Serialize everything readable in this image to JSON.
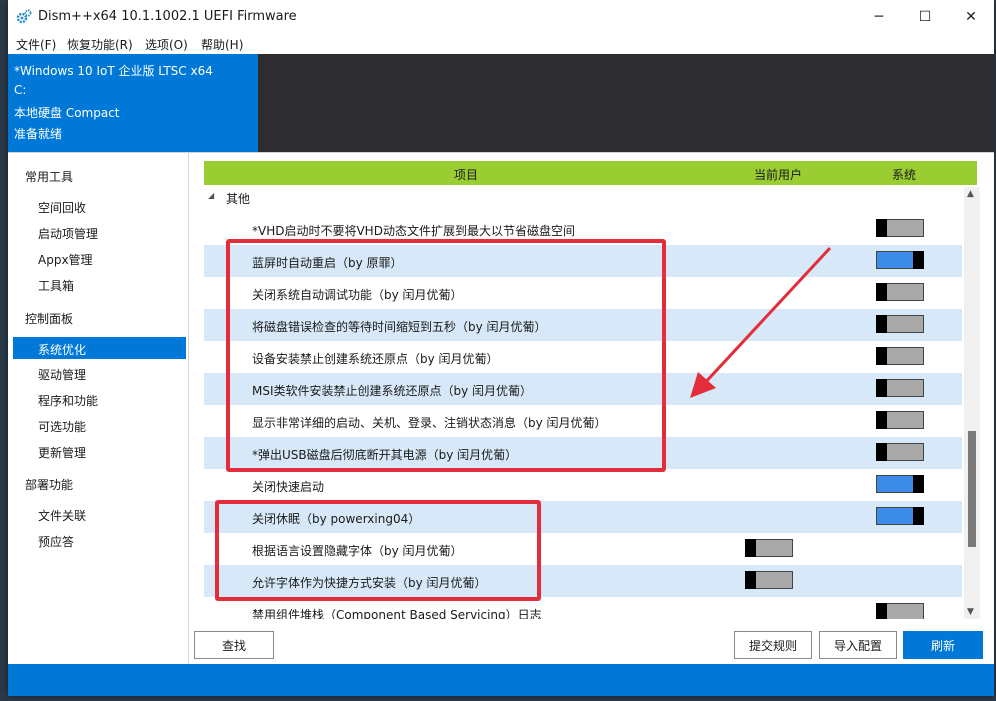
{
  "window": {
    "title": "Dism++x64 10.1.1002.1 UEFI Firmware",
    "minimize": "─",
    "maximize": "☐",
    "close": "✕"
  },
  "menu": [
    "文件(F)",
    "恢复功能(R)",
    "选项(O)",
    "帮助(H)"
  ],
  "info": {
    "os": "*Windows 10 IoT 企业版 LTSC x64",
    "drive": "C:",
    "disk": "本地硬盘 Compact",
    "status": "准备就绪"
  },
  "sidebar": {
    "groups": [
      {
        "label": "常用工具",
        "items": [
          "空间回收",
          "启动项管理",
          "Appx管理",
          "工具箱"
        ]
      },
      {
        "label": "控制面板",
        "items": [
          "系统优化",
          "驱动管理",
          "程序和功能",
          "可选功能",
          "更新管理"
        ]
      },
      {
        "label": "部署功能",
        "items": [
          "文件关联",
          "预应答"
        ]
      }
    ],
    "selected": "系统优化"
  },
  "table": {
    "col_item": "项目",
    "col_user": "当前用户",
    "col_system": "系统",
    "group_label": "其他",
    "rows": [
      {
        "label": "*VHD启动时不要将VHD动态文件扩展到最大以节省磁盘空间",
        "system": "off"
      },
      {
        "label": "蓝屏时自动重启（by 原罪）",
        "system": "on"
      },
      {
        "label": "关闭系统自动调试功能（by 闰月优葡）",
        "system": "off"
      },
      {
        "label": "将磁盘错误检查的等待时间缩短到五秒（by 闰月优葡）",
        "system": "off"
      },
      {
        "label": "设备安装禁止创建系统还原点（by 闰月优葡）",
        "system": "off"
      },
      {
        "label": "MSI类软件安装禁止创建系统还原点（by 闰月优葡）",
        "system": "off"
      },
      {
        "label": "显示非常详细的启动、关机、登录、注销状态消息（by 闰月优葡）",
        "system": "off"
      },
      {
        "label": "*弹出USB磁盘后彻底断开其电源（by 闰月优葡）",
        "system": "off"
      },
      {
        "label": "关闭快速启动",
        "system": "on"
      },
      {
        "label": "关闭休眠（by powerxing04）",
        "system": "on"
      },
      {
        "label": "根据语言设置隐藏字体（by 闰月优葡）",
        "user": "off"
      },
      {
        "label": "允许字体作为快捷方式安装（by 闰月优葡）",
        "user": "off"
      },
      {
        "label": "禁用组件堆栈（Component Based Servicing）日志",
        "system": "off"
      }
    ]
  },
  "buttons": {
    "find": "查找",
    "submit": "提交规则",
    "import": "导入配置",
    "refresh": "刷新"
  },
  "icons": {
    "collapse": "triangle-down-icon",
    "app": "gear-icon"
  }
}
